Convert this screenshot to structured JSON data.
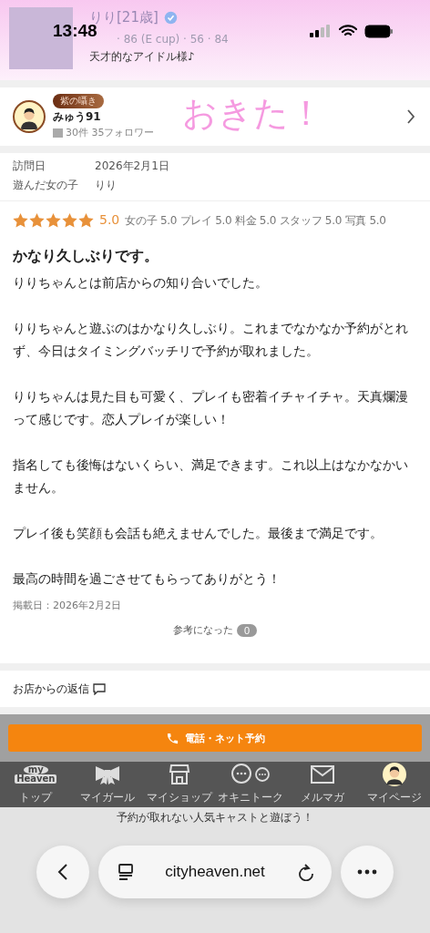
{
  "status_bar": {
    "time": "13:48"
  },
  "cast_header": {
    "name": "りり[21歳]",
    "verified": true,
    "measurements": "· 86 (E cup) · 56 · 84",
    "catchphrase": "天才的なアイドル様♪"
  },
  "reviewer": {
    "badge": "紫の囁き",
    "name": "みゅう91",
    "stats": "30件  35フォロワー"
  },
  "visit_info": [
    {
      "label": "訪問日",
      "value": "2026年2月1日"
    },
    {
      "label": "遊んだ女の子",
      "value": "りり"
    }
  ],
  "rating": {
    "stars": 5,
    "score": "5.0",
    "breakdown": "女の子 5.0 プレイ 5.0 料金 5.0 スタッフ 5.0 写真 5.0"
  },
  "review": {
    "title": "かなり久しぶりです。",
    "paragraphs": [
      "りりちゃんとは前店からの知り合いでした。",
      "りりちゃんと遊ぶのはかなり久しぶり。これまでなかなか予約がとれず、今日はタイミングバッチリで予約が取れました。",
      "りりちゃんは見た目も可愛く、プレイも密着イチャイチャ。天真爛漫って感じです。恋人プレイが楽しい！",
      "指名しても後悔はないくらい、満足できます。これ以上はなかなかいません。",
      "プレイ後も笑顔も会話も絶えませんでした。最後まで満足です。",
      "最高の時間を過ごさせてもらってありがとう！"
    ],
    "posted": "掲載日：2026年2月2日",
    "helpful_label": "参考になった",
    "helpful_count": "0"
  },
  "handwriting": "おきた！",
  "shop_reply": {
    "title": "お店からの返信"
  },
  "booking_button": "電話・ネット予約",
  "bottom_nav": [
    {
      "kind": "logo",
      "logo_top": "my",
      "logo_bottom": "Heaven",
      "label": "トップ"
    },
    {
      "kind": "ribbon",
      "label": "マイガール"
    },
    {
      "kind": "shop",
      "label": "マイショップ"
    },
    {
      "kind": "chat",
      "label": "オキニトーク"
    },
    {
      "kind": "mail",
      "label": "メルマガ"
    },
    {
      "kind": "avatar",
      "label": "マイページ"
    }
  ],
  "promo": "予約が取れない人気キャストと遊ぼう！",
  "browser": {
    "url": "cityheaven.net"
  }
}
